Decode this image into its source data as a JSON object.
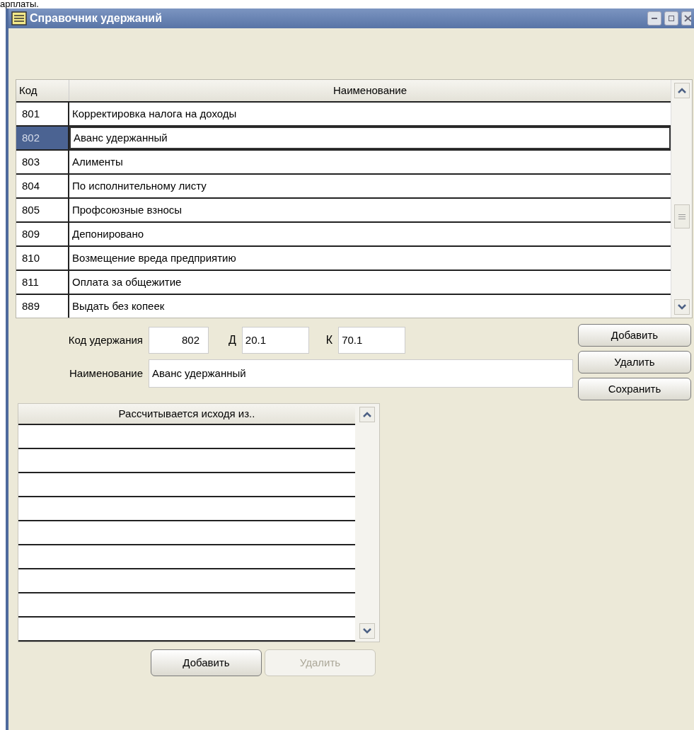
{
  "page_caption": "арплаты.",
  "window": {
    "title": "Справочник удержаний"
  },
  "table": {
    "columns": [
      "Код",
      "Наименование"
    ],
    "rows": [
      {
        "code": "801",
        "name": "Корректировка налога на доходы",
        "selected": false
      },
      {
        "code": "802",
        "name": "Аванс удержанный",
        "selected": true
      },
      {
        "code": "803",
        "name": "Алименты",
        "selected": false
      },
      {
        "code": "804",
        "name": "По исполнительному листу",
        "selected": false
      },
      {
        "code": "805",
        "name": "Профсоюзные взносы",
        "selected": false
      },
      {
        "code": "809",
        "name": "Депонировано",
        "selected": false
      },
      {
        "code": "810",
        "name": "Возмещение вреда предприятию",
        "selected": false
      },
      {
        "code": "811",
        "name": "Оплата за общежитие",
        "selected": false
      },
      {
        "code": "889",
        "name": "Выдать без копеек",
        "selected": false
      }
    ]
  },
  "form": {
    "code_label": "Код удержания",
    "code_value": "802",
    "debit_label": "Д",
    "debit_value": "20.1",
    "credit_label": "К",
    "credit_value": "70.1",
    "name_label": "Наименование",
    "name_value": "Аванс удержанный"
  },
  "side_buttons": [
    {
      "label": "Добавить",
      "disabled": false
    },
    {
      "label": "Удалить",
      "disabled": false
    },
    {
      "label": "Сохранить",
      "disabled": false
    }
  ],
  "basis_table": {
    "column": "Рассчитывается исходя из.."
  },
  "basis_buttons": [
    {
      "label": "Добавить",
      "disabled": false
    },
    {
      "label": "Удалить",
      "disabled": true
    }
  ]
}
